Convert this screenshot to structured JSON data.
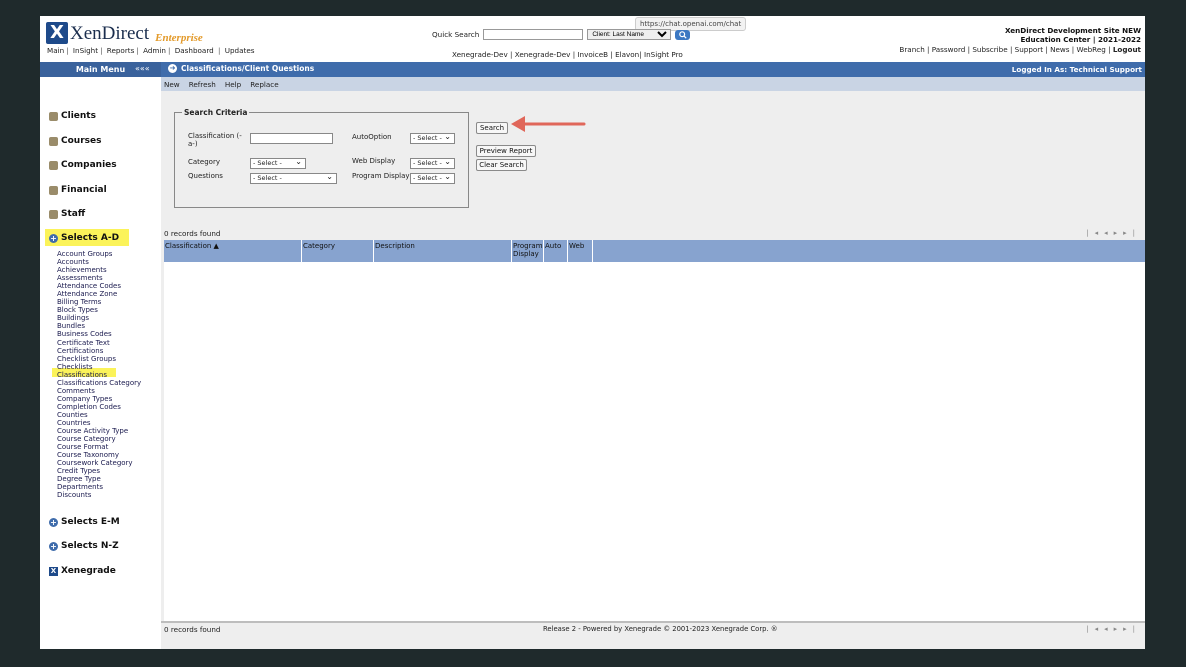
{
  "header": {
    "brand": "XenDirect",
    "edition": "Enterprise",
    "nav": [
      "Main",
      "InSight",
      "Reports",
      "Admin",
      "Dashboard",
      "Updates"
    ],
    "quick_search_label": "Quick Search",
    "quick_search_value": "",
    "client_select": "Client: Last Name",
    "tooltip_url": "https://chat.openai.com/chat",
    "env_links": [
      "Xenegrade-Dev",
      "Xenegrade-Dev",
      "InvoiceB",
      "Elavon",
      "InSight Pro"
    ],
    "site_line1": "XenDirect Development Site NEW",
    "site_line2": "Education Center",
    "site_year": "2021-2022",
    "user_links": [
      "Branch",
      "Password",
      "Subscribe",
      "Support",
      "News",
      "WebReg"
    ],
    "logout": "Logout"
  },
  "menu_bar": {
    "main_menu": "Main Menu",
    "collapse": "«««",
    "page_title": "Classifications/Client Questions",
    "logged_in": "Logged In As: Technical Support"
  },
  "sidebar": {
    "categories": [
      "Clients",
      "Courses",
      "Companies",
      "Financial",
      "Staff",
      "Selects A-D",
      "Selects E-M",
      "Selects N-Z",
      "Xenegrade"
    ],
    "sub_items": [
      "Account Groups",
      "Accounts",
      "Achievements",
      "Assessments",
      "Attendance Codes",
      "Attendance Zone",
      "Billing Terms",
      "Block Types",
      "Buildings",
      "Bundles",
      "Business Codes",
      "Certificate Text",
      "Certifications",
      "Checklist Groups",
      "Checklists",
      "Classifications",
      "Classifications Category",
      "Comments",
      "Company Types",
      "Completion Codes",
      "Counties",
      "Countries",
      "Course Activity Type",
      "Course Category",
      "Course Format",
      "Course Taxonomy",
      "Coursework Category",
      "Credit Types",
      "Degree Type",
      "Departments",
      "Discounts"
    ]
  },
  "toolbar": [
    "New",
    "Refresh",
    "Help",
    "Replace"
  ],
  "criteria": {
    "legend": "Search Criteria",
    "classification_label": "Classification (- a-)",
    "classification_value": "",
    "category_label": "Category",
    "questions_label": "Questions",
    "autooption_label": "AutoOption",
    "webdisplay_label": "Web Display",
    "programdisplay_label": "Program Display",
    "select_default": "- Select -"
  },
  "buttons": {
    "search": "Search",
    "preview": "Preview Report",
    "clear": "Clear Search"
  },
  "records_found": "0 records found",
  "grid_columns": [
    "Classification ▲",
    "Category",
    "Description",
    "Program Display",
    "Auto",
    "Web"
  ],
  "footer": "Release 2 - Powered by Xenegrade © 2001-2023 Xenegrade Corp. ®",
  "colors": {
    "bar": "#3f6cab",
    "highlight": "#fbf35a",
    "arrow": "#e0675a"
  }
}
